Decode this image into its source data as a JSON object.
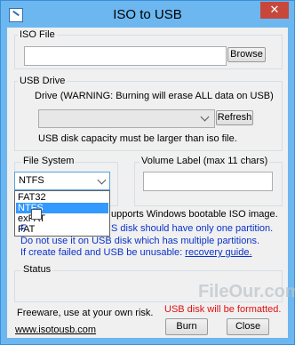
{
  "window": {
    "title": "ISO to USB",
    "close_glyph": "✕"
  },
  "iso_file": {
    "group_label": "ISO File",
    "path_value": "",
    "browse_label": "Browse"
  },
  "usb_drive": {
    "group_label": "USB Drive",
    "drive_label": "Drive (WARNING: Burning will erase ALL data on USB)",
    "drive_value": "",
    "refresh_label": "Refresh",
    "capacity_note": "USB disk capacity must be larger than iso file."
  },
  "file_system": {
    "group_label": "File System",
    "selected": "NTFS",
    "options": [
      "FAT32",
      "NTFS",
      "exFAT",
      "FAT"
    ]
  },
  "volume_label": {
    "group_label": "Volume Label (max 11 chars)",
    "value": ""
  },
  "bootable": {
    "label_visible": "upports Windows bootable ISO image."
  },
  "notes": {
    "line1_visible": "S disk should have only one partition.",
    "line1_prefix": "F",
    "line2": "Do not use it on USB disk which has multiple partitions.",
    "line3_prefix": "If create failed and USB be unusable: ",
    "line3_link": "recovery guide."
  },
  "status": {
    "group_label": "Status",
    "text": ""
  },
  "footer": {
    "freeware": "Freeware, use at your own risk.",
    "formatted_warning": "USB disk will be formatted.",
    "website": "www.isotousb.com",
    "burn_label": "Burn",
    "close_label": "Close"
  },
  "watermark": {
    "text": "FileOur.com"
  },
  "colors": {
    "titlebar": "#6cb7f0",
    "selection": "#3399ff",
    "link": "#0b32c8",
    "warning": "#e01010"
  }
}
